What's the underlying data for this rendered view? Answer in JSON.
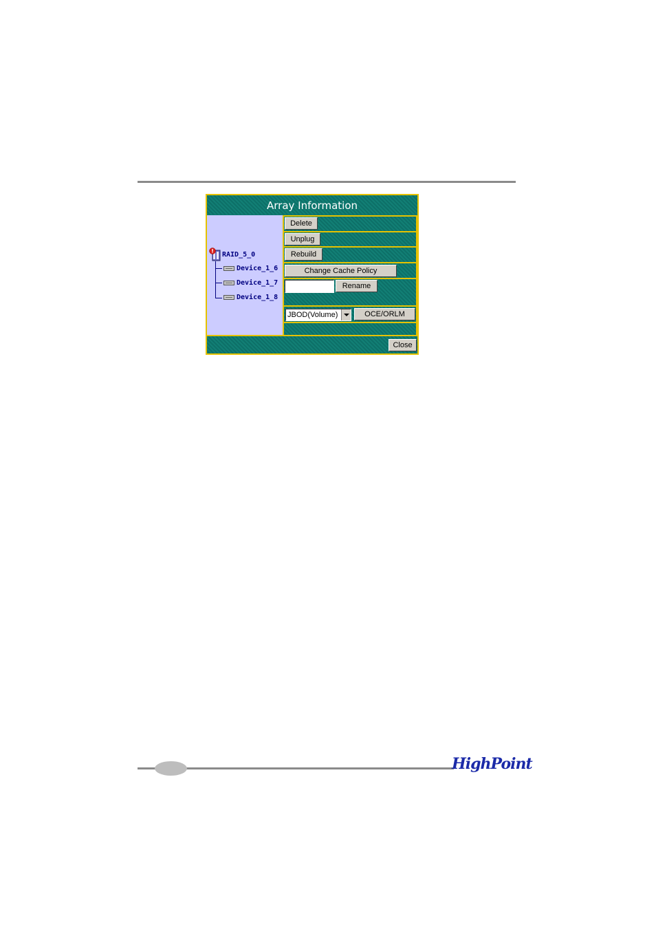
{
  "dialog": {
    "title": "Array Information",
    "tree": {
      "array_label": "RAID_5_0",
      "devices": [
        "Device_1_6",
        "Device_1_7",
        "Device_1_8"
      ]
    },
    "buttons": {
      "delete": "Delete",
      "unplug": "Unplug",
      "rebuild": "Rebuild",
      "change_cache_policy": "Change Cache Policy",
      "rename": "Rename",
      "oce_orlm": "OCE/ORLM",
      "close": "Close"
    },
    "rename_input": {
      "value": ""
    },
    "array_type_select": {
      "selected": "JBOD(Volume)"
    }
  },
  "footer": {
    "logo_text": "HighPoint"
  },
  "colors": {
    "panel_teal": "#0f7a70",
    "border_yellow": "#e6c200",
    "tree_background": "#ccccff",
    "tree_text": "#000080",
    "logo_blue": "#1b2aa8"
  }
}
